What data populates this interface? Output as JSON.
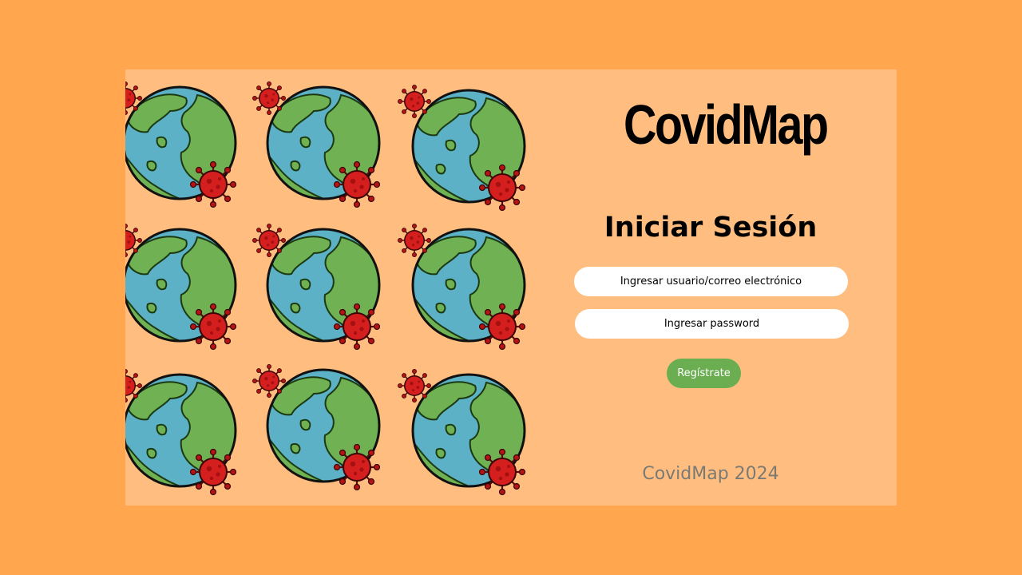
{
  "brand": {
    "logo_text": "CovidMap"
  },
  "login": {
    "heading": "Iniciar Sesión",
    "user_placeholder": "Ingresar usuario/correo electrónico",
    "password_placeholder": "Ingresar password",
    "register_label": "Regístrate"
  },
  "footer": {
    "text": "CovidMap 2024"
  },
  "illustration": {
    "icon": "earth-with-virus-icon",
    "rows": 3,
    "columns": 3
  },
  "colors": {
    "page_background": "#FFA64F",
    "card_background": "#FFBE80",
    "button": "#6AAE51",
    "ocean": "#5DB1C7",
    "land": "#6FB153",
    "virus": "#D51F1F",
    "footer_text": "#7A7A74"
  }
}
